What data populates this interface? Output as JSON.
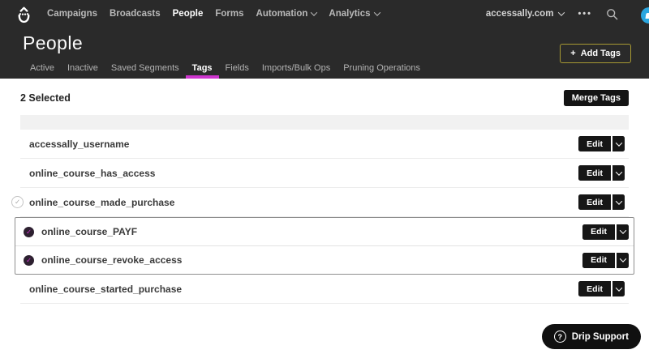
{
  "nav": {
    "items": [
      {
        "label": "Campaigns"
      },
      {
        "label": "Broadcasts"
      },
      {
        "label": "People",
        "active": true
      },
      {
        "label": "Forms"
      },
      {
        "label": "Automation",
        "chevron": true
      },
      {
        "label": "Analytics",
        "chevron": true
      }
    ],
    "account_label": "accessally.com",
    "more_glyph": "•••"
  },
  "page": {
    "title": "People",
    "add_tags_plus": "+",
    "add_tags_label": "Add Tags"
  },
  "tabs": {
    "items": [
      {
        "label": "Active"
      },
      {
        "label": "Inactive"
      },
      {
        "label": "Saved Segments"
      },
      {
        "label": "Tags",
        "active": true
      },
      {
        "label": "Fields"
      },
      {
        "label": "Imports/Bulk Ops"
      },
      {
        "label": "Pruning Operations"
      }
    ]
  },
  "toolbar": {
    "selected_text": "2 Selected",
    "merge_label": "Merge Tags"
  },
  "table": {
    "edit_label": "Edit",
    "check_glyph": "✓",
    "groups": [
      {
        "style": "plain",
        "rows": [
          {
            "label": "accessally_username",
            "check": "none"
          },
          {
            "label": "online_course_has_access",
            "check": "none"
          },
          {
            "label": "online_course_made_purchase",
            "check": "unchecked"
          }
        ]
      },
      {
        "style": "selected",
        "rows": [
          {
            "label": "online_course_PAYF",
            "check": "checked"
          },
          {
            "label": "online_course_revoke_access",
            "check": "checked"
          }
        ]
      },
      {
        "style": "plain",
        "rows": [
          {
            "label": "online_course_started_purchase",
            "check": "none"
          }
        ]
      }
    ]
  },
  "support": {
    "label": "Drip Support"
  },
  "colors": {
    "accent": "#cd34cd",
    "header_bg": "#2a2a2a",
    "add_tags_border": "#a89a33",
    "notification_blue": "#2ba6df"
  }
}
